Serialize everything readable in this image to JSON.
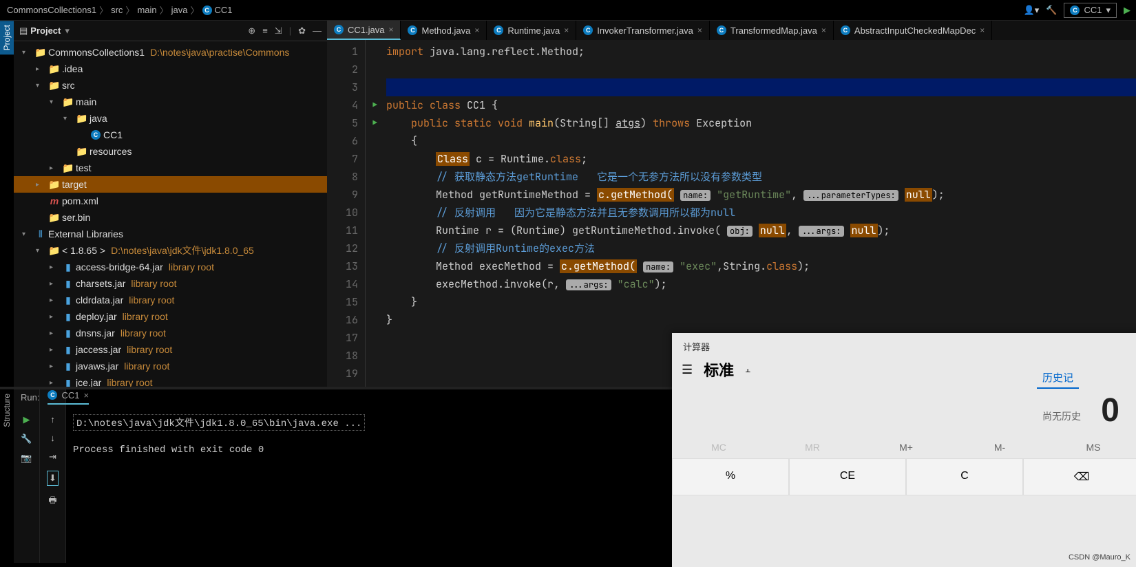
{
  "breadcrumb": [
    "CommonsCollections1",
    "src",
    "main",
    "java",
    "CC1"
  ],
  "run_config": "CC1",
  "project_panel": {
    "title": "Project",
    "tree": [
      {
        "d": 0,
        "arr": "▾",
        "ico": "folder",
        "lbl": "CommonsCollections1",
        "note": "D:\\notes\\java\\practise\\Commons"
      },
      {
        "d": 1,
        "arr": "▸",
        "ico": "folder",
        "lbl": ".idea"
      },
      {
        "d": 1,
        "arr": "▾",
        "ico": "folder",
        "lbl": "src"
      },
      {
        "d": 2,
        "arr": "▾",
        "ico": "folder",
        "lbl": "main"
      },
      {
        "d": 3,
        "arr": "▾",
        "ico": "folder-blue",
        "lbl": "java"
      },
      {
        "d": 4,
        "arr": "",
        "ico": "class",
        "lbl": "CC1"
      },
      {
        "d": 3,
        "arr": "",
        "ico": "folder-res",
        "lbl": "resources"
      },
      {
        "d": 2,
        "arr": "▸",
        "ico": "folder",
        "lbl": "test"
      },
      {
        "d": 1,
        "arr": "▸",
        "ico": "folder-red",
        "lbl": "target",
        "sel": true
      },
      {
        "d": 1,
        "arr": "",
        "ico": "maven",
        "lbl": "pom.xml"
      },
      {
        "d": 1,
        "arr": "",
        "ico": "file",
        "lbl": "ser.bin"
      },
      {
        "d": 0,
        "arr": "▾",
        "ico": "lib",
        "lbl": "External Libraries"
      },
      {
        "d": 1,
        "arr": "▾",
        "ico": "folder",
        "lbl": "< 1.8.65 >",
        "note": "D:\\notes\\java\\jdk文件\\jdk1.8.0_65"
      },
      {
        "d": 2,
        "arr": "▸",
        "ico": "jar",
        "lbl": "access-bridge-64.jar",
        "note": "library root"
      },
      {
        "d": 2,
        "arr": "▸",
        "ico": "jar",
        "lbl": "charsets.jar",
        "note": "library root"
      },
      {
        "d": 2,
        "arr": "▸",
        "ico": "jar",
        "lbl": "cldrdata.jar",
        "note": "library root"
      },
      {
        "d": 2,
        "arr": "▸",
        "ico": "jar",
        "lbl": "deploy.jar",
        "note": "library root"
      },
      {
        "d": 2,
        "arr": "▸",
        "ico": "jar",
        "lbl": "dnsns.jar",
        "note": "library root"
      },
      {
        "d": 2,
        "arr": "▸",
        "ico": "jar",
        "lbl": "jaccess.jar",
        "note": "library root"
      },
      {
        "d": 2,
        "arr": "▸",
        "ico": "jar",
        "lbl": "javaws.jar",
        "note": "library root"
      },
      {
        "d": 2,
        "arr": "▸",
        "ico": "jar",
        "lbl": "jce.jar",
        "note": "library root"
      }
    ]
  },
  "tabs": [
    {
      "label": "CC1.java",
      "active": true
    },
    {
      "label": "Method.java"
    },
    {
      "label": "Runtime.java"
    },
    {
      "label": "InvokerTransformer.java"
    },
    {
      "label": "TransformedMap.java"
    },
    {
      "label": "AbstractInputCheckedMapDec"
    }
  ],
  "code": {
    "l1": "import java.lang.reflect.Method;",
    "l4": "public class CC1 {",
    "l5_a": "public static void",
    "l5_b": "main",
    "l5_c": "(String[] ",
    "l5_d": "atgs",
    "l5_e": ") ",
    "l5_f": "throws",
    "l5_g": " Exception",
    "l6": "{",
    "l7_a": "Class",
    "l7_b": " c = Runtime.",
    "l7_c": "class",
    "l7_d": ";",
    "l8": "// 获取静态方法getRuntime   它是一个无参方法所以没有参数类型",
    "l9_a": "Method getRuntimeMethod = ",
    "l9_b": "c.getMethod(",
    "l9_h1": "name:",
    "l9_s": "\"getRuntime\"",
    "l9_c": ", ",
    "l9_h2": "...parameterTypes:",
    "l9_n": "null",
    "l9_d": ");",
    "l10": "// 反射调用   因为它是静态方法并且无参数调用所以都为null",
    "l11_a": "Runtime r = (Runtime) getRuntimeMethod.invoke(",
    "l11_h1": "obj:",
    "l11_n1": "null",
    "l11_b": ", ",
    "l11_h2": "...args:",
    "l11_n2": "null",
    "l11_c": ");",
    "l12": "// 反射调用Runtime的exec方法",
    "l13_a": "Method execMethod = ",
    "l13_b": "c.getMethod(",
    "l13_h1": "name:",
    "l13_s": "\"exec\"",
    "l13_c": ",String.",
    "l13_d": "class",
    "l13_e": ");",
    "l14_a": "execMethod.invoke(r, ",
    "l14_h1": "...args:",
    "l14_s": "\"calc\"",
    "l14_b": ");",
    "l15": "}",
    "l16": "}"
  },
  "line_numbers": [
    "1",
    "2",
    "3",
    "4",
    "5",
    "6",
    "7",
    "8",
    "9",
    "10",
    "11",
    "12",
    "13",
    "14",
    "15",
    "16",
    "17",
    "18",
    "19"
  ],
  "run": {
    "label": "Run:",
    "tab": "CC1",
    "cmd": "D:\\notes\\java\\jdk文件\\jdk1.8.0_65\\bin\\java.exe ...",
    "exit": "Process finished with exit code 0"
  },
  "calc": {
    "title": "计算器",
    "mode": "标准",
    "display": "0",
    "history_tab": "历史记",
    "history_empty": "尚无历史",
    "mem": [
      "MC",
      "MR",
      "M+",
      "M-",
      "MS"
    ],
    "btns": [
      "%",
      "CE",
      "C",
      "⌫"
    ]
  },
  "side": {
    "project": "Project",
    "structure": "Structure"
  },
  "watermark": "CSDN @Mauro_K"
}
